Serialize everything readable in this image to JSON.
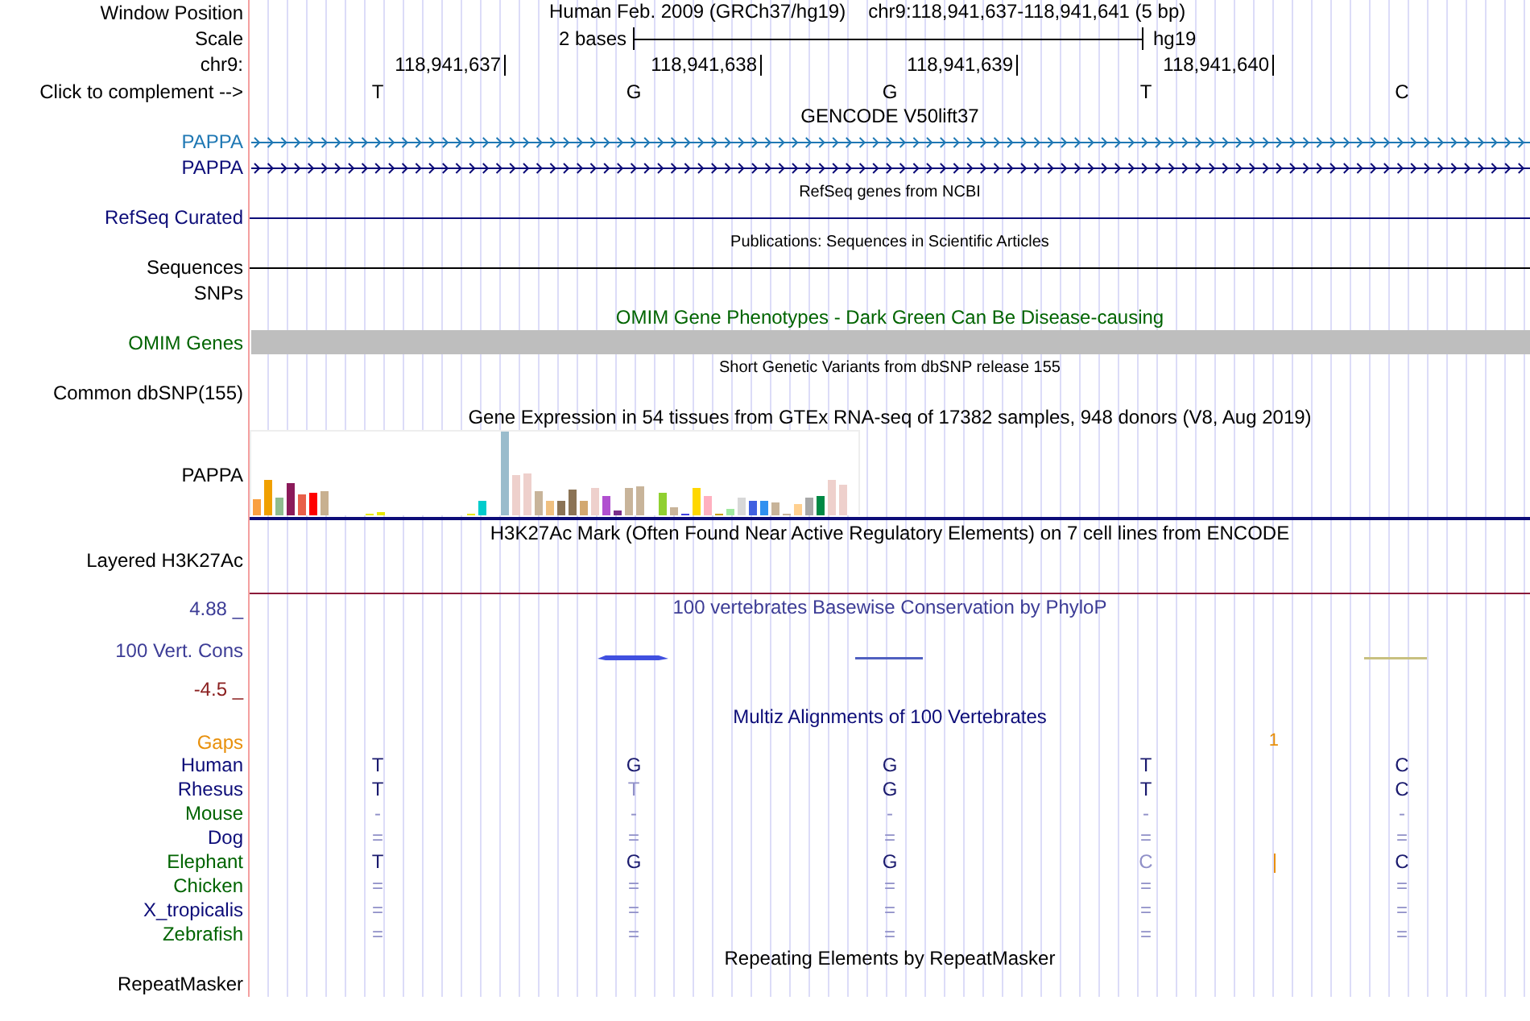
{
  "position": {
    "label": "Window Position",
    "assembly": "Human Feb. 2009 (GRCh37/hg19)",
    "range": "chr9:118,941,637-118,941,641 (5 bp)"
  },
  "scale": {
    "label": "Scale",
    "span": "2 bases",
    "assembly": "hg19"
  },
  "ruler": {
    "label": "chr9:",
    "ticks": [
      "118,941,637",
      "118,941,638",
      "118,941,639",
      "118,941,640"
    ]
  },
  "sequence": {
    "label": "Click to complement -->",
    "bases": [
      "T",
      "G",
      "G",
      "T",
      "C"
    ]
  },
  "tracks": [
    {
      "kind": "title",
      "text": "GENCODE V50lift37",
      "color": "#000000"
    },
    {
      "kind": "gene",
      "label": "PAPPA",
      "color": "#1f78b4"
    },
    {
      "kind": "gene",
      "label": "PAPPA",
      "color": "#0c0c78"
    },
    {
      "kind": "note",
      "text": "RefSeq genes from NCBI"
    },
    {
      "kind": "line",
      "label": "RefSeq Curated",
      "color": "#0c0c78"
    },
    {
      "kind": "note",
      "text": "Publications: Sequences in Scientific Articles"
    },
    {
      "kind": "line",
      "label": "Sequences",
      "color": "#000000"
    },
    {
      "kind": "label",
      "label": "SNPs",
      "color": "#000000"
    },
    {
      "kind": "title",
      "text": "OMIM Gene Phenotypes - Dark Green Can Be Disease-causing",
      "color": "#006400"
    },
    {
      "kind": "bar",
      "label": "OMIM Genes",
      "color": "#006400"
    },
    {
      "kind": "note",
      "text": "Short Genetic Variants from dbSNP release 155"
    },
    {
      "kind": "label",
      "label": "Common dbSNP(155)",
      "color": "#000000"
    },
    {
      "kind": "title",
      "text": "Gene Expression in 54 tissues from GTEx RNA-seq of 17382 samples, 948 donors (V8, Aug 2019)",
      "color": "#000000"
    },
    {
      "kind": "expression",
      "label": "PAPPA",
      "color": "#000000"
    },
    {
      "kind": "title",
      "text": "H3K27Ac Mark (Often Found Near Active Regulatory Elements) on 7 cell lines from ENCODE",
      "color": "#000000"
    },
    {
      "kind": "signal",
      "label": "Layered H3K27Ac",
      "color": "#000000"
    },
    {
      "kind": "conservation",
      "title": "100 vertebrates Basewise Conservation by PhyloP",
      "max": "4.88 _",
      "label": "100 Vert. Cons",
      "min": "-4.5 _",
      "color": "#3c3c96"
    },
    {
      "kind": "title",
      "text": "Multiz Alignments of 100 Vertebrates",
      "color": "#0c0c78"
    },
    {
      "kind": "gaps",
      "label": "Gaps",
      "color": "#e8900c",
      "mark": "1"
    },
    {
      "kind": "species",
      "label": "Human",
      "color": "#0c0c78",
      "bases": [
        {
          "text": "T",
          "faded": false
        },
        {
          "text": "G",
          "faded": false
        },
        {
          "text": "G",
          "faded": false
        },
        {
          "text": "T",
          "faded": false
        },
        {
          "text": "C",
          "faded": false
        }
      ]
    },
    {
      "kind": "species",
      "label": "Rhesus",
      "color": "#0c0c78",
      "bases": [
        {
          "text": "T",
          "faded": false
        },
        {
          "text": "T",
          "faded": true
        },
        {
          "text": "G",
          "faded": false
        },
        {
          "text": "T",
          "faded": false
        },
        {
          "text": "C",
          "faded": false
        }
      ]
    },
    {
      "kind": "species",
      "label": "Mouse",
      "color": "#006400",
      "bases": [
        {
          "text": "-",
          "faded": true
        },
        {
          "text": "-",
          "faded": true
        },
        {
          "text": "-",
          "faded": true
        },
        {
          "text": "-",
          "faded": true
        },
        {
          "text": "-",
          "faded": true
        }
      ]
    },
    {
      "kind": "species",
      "label": "Dog",
      "color": "#0c0c78",
      "bases": [
        {
          "text": "=",
          "faded": true
        },
        {
          "text": "=",
          "faded": true
        },
        {
          "text": "=",
          "faded": true
        },
        {
          "text": "=",
          "faded": true
        },
        {
          "text": "=",
          "faded": true
        }
      ]
    },
    {
      "kind": "species",
      "label": "Elephant",
      "color": "#006400",
      "insertion": true,
      "bases": [
        {
          "text": "T",
          "faded": false
        },
        {
          "text": "G",
          "faded": false
        },
        {
          "text": "G",
          "faded": false
        },
        {
          "text": "C",
          "faded": true
        },
        {
          "text": "C",
          "faded": false
        }
      ]
    },
    {
      "kind": "species",
      "label": "Chicken",
      "color": "#006400",
      "bases": [
        {
          "text": "=",
          "faded": true
        },
        {
          "text": "=",
          "faded": true
        },
        {
          "text": "=",
          "faded": true
        },
        {
          "text": "=",
          "faded": true
        },
        {
          "text": "=",
          "faded": true
        }
      ]
    },
    {
      "kind": "species",
      "label": "X_tropicalis",
      "color": "#0c0c78",
      "bases": [
        {
          "text": "=",
          "faded": true
        },
        {
          "text": "=",
          "faded": true
        },
        {
          "text": "=",
          "faded": true
        },
        {
          "text": "=",
          "faded": true
        },
        {
          "text": "=",
          "faded": true
        }
      ]
    },
    {
      "kind": "species",
      "label": "Zebrafish",
      "color": "#006400",
      "bases": [
        {
          "text": "=",
          "faded": true
        },
        {
          "text": "=",
          "faded": true
        },
        {
          "text": "=",
          "faded": true
        },
        {
          "text": "=",
          "faded": true
        },
        {
          "text": "=",
          "faded": true
        }
      ]
    },
    {
      "kind": "title",
      "text": "Repeating Elements by RepeatMasker",
      "color": "#000000"
    },
    {
      "kind": "label",
      "label": "RepeatMasker",
      "color": "#000000"
    }
  ]
}
